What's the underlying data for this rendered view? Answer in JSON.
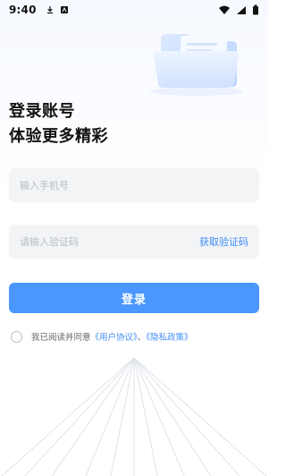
{
  "status_bar": {
    "time": "9:40",
    "left_icons": [
      "download-icon",
      "app-notification-icon"
    ],
    "right_icons": [
      "wifi-icon",
      "signal-icon",
      "battery-icon"
    ]
  },
  "headline": {
    "line1": "登录账号",
    "line2": "体验更多精彩"
  },
  "form": {
    "phone_placeholder": "输入手机号",
    "code_placeholder": "请输入验证码",
    "get_code_label": "获取验证码",
    "login_label": "登录"
  },
  "agreement": {
    "prefix": "我已阅读并同意",
    "user_agreement": "《用户协议》",
    "separator": "、",
    "privacy_policy": "《隐私政策》"
  },
  "colors": {
    "accent": "#4a97ff",
    "link": "#3f8df7",
    "input_bg": "#f3f4f6"
  }
}
